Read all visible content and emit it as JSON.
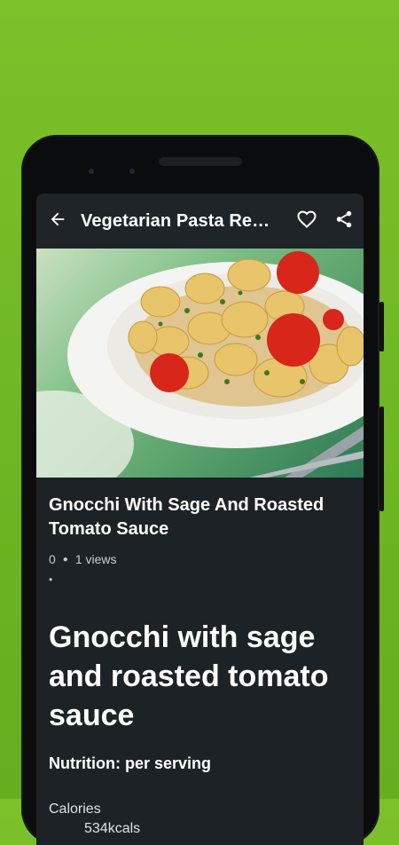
{
  "appbar": {
    "title": "Vegetarian Pasta Re…",
    "back_icon": "arrow-back-icon",
    "favorite_icon": "heart-outline-icon",
    "share_icon": "share-icon"
  },
  "recipe": {
    "title": " Gnocchi With Sage And Roasted Tomato Sauce",
    "likes": "0",
    "views": "1 views",
    "bullet": "•",
    "heading": "Gnocchi with sage and roasted tomato sauce",
    "nutrition_label": "Nutrition: per serving",
    "calories_label": "Calories",
    "calories_value": "534kcals"
  },
  "colors": {
    "background_green": "#76bd27",
    "screen_bg": "#1d2226",
    "text": "#ffffff"
  }
}
